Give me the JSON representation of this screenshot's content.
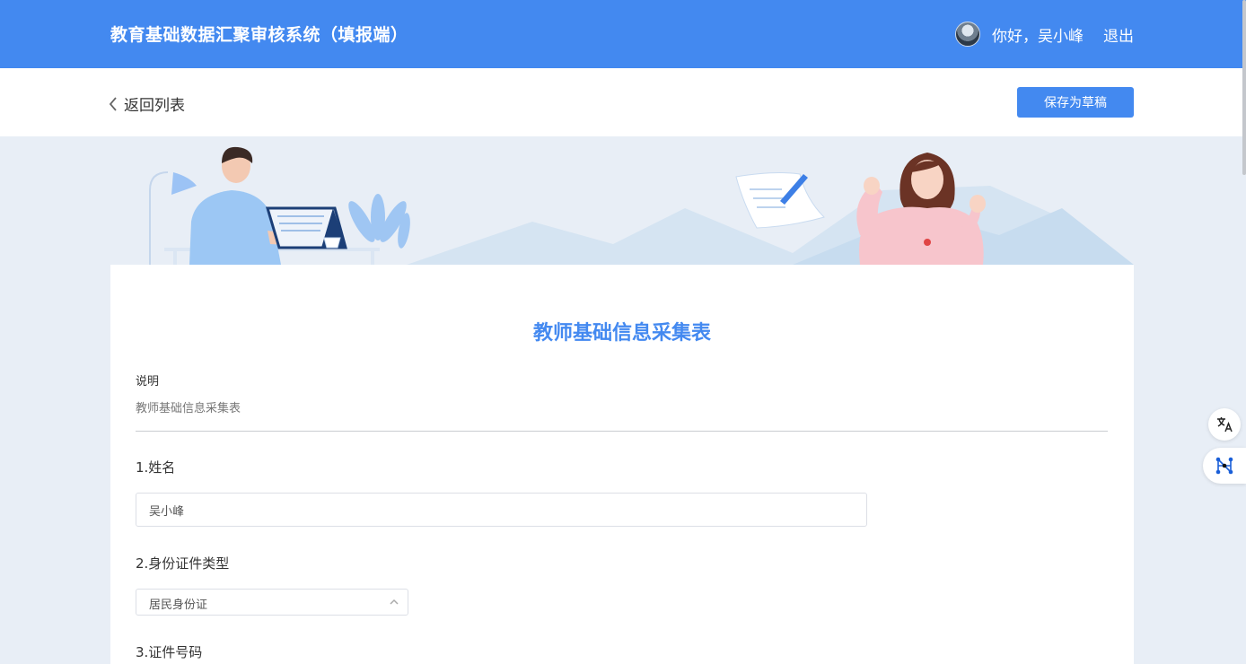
{
  "header": {
    "title": "教育基础数据汇聚审核系统（填报端）",
    "greeting": "你好，吴小峰",
    "logout_label": "退出"
  },
  "subbar": {
    "back_label": "返回列表",
    "save_label": "保存为草稿"
  },
  "form": {
    "title": "教师基础信息采集表",
    "description_label": "说明",
    "description_text": "教师基础信息采集表",
    "questions": [
      {
        "label": "1.姓名",
        "value": "吴小峰"
      },
      {
        "label": "2.身份证件类型",
        "value": "居民身份证"
      },
      {
        "label": "3.证件号码"
      }
    ]
  },
  "colors": {
    "brand": "#4389f0",
    "page_background": "#e8eef6"
  },
  "icons": {
    "back": "chevron-left-icon",
    "select": "chevron-up-icon",
    "translate": "translate-icon",
    "network": "network-icon"
  }
}
